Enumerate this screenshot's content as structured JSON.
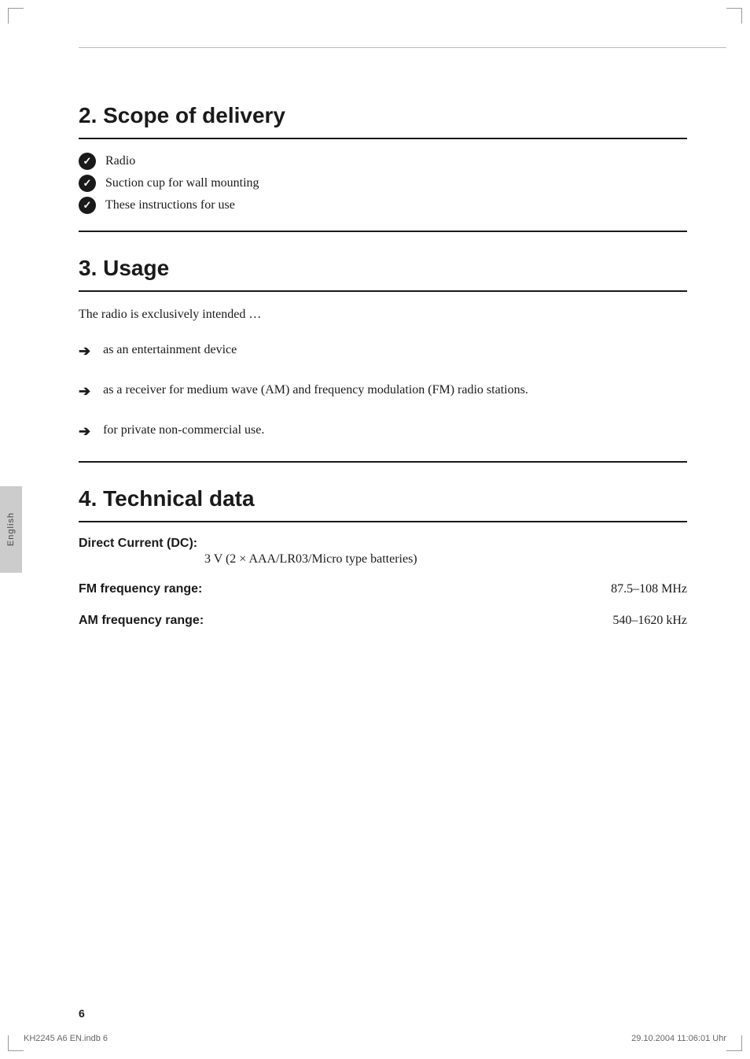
{
  "page": {
    "number": "6",
    "footer_left": "KH2245 A6 EN.indb   6",
    "footer_right": "29.10.2004   11:06:01 Uhr"
  },
  "side_tab": {
    "text": "English"
  },
  "section2": {
    "title": "2. Scope of delivery",
    "items": [
      {
        "text": "Radio"
      },
      {
        "text": "Suction cup for wall mounting"
      },
      {
        "text": "These instructions for use"
      }
    ]
  },
  "section3": {
    "title": "3. Usage",
    "intro": "The radio is exclusively intended …",
    "bullet_items": [
      {
        "text": "as an entertainment device"
      },
      {
        "text": "as a receiver for medium wave (AM) and frequency modulation (FM) radio stations."
      },
      {
        "text": "for private non-commercial use."
      }
    ]
  },
  "section4": {
    "title": "4. Technical data",
    "dc_label": "Direct Current (DC)",
    "dc_value": "3 V (2 × AAA/LR03/Micro type batteries)",
    "fm_label": "FM frequency range",
    "fm_value": "87.5–108 MHz",
    "am_label": "AM frequency range",
    "am_value": "540–1620 kHz"
  }
}
